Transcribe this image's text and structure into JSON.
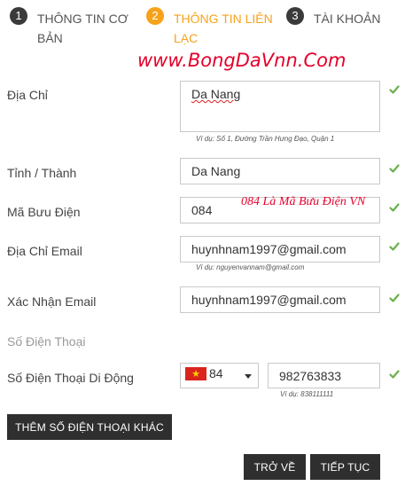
{
  "steps": [
    {
      "number": "1",
      "label_line1": "THÔNG TIN CƠ",
      "label_line2": "BẢN",
      "active": false
    },
    {
      "number": "2",
      "label_line1": "THÔNG TIN LIÊN",
      "label_line2": "LẠC",
      "active": true
    },
    {
      "number": "3",
      "label_line1": "TÀI KHOẢN",
      "label_line2": "",
      "active": false
    }
  ],
  "watermark": "www.BongDaVnn.Com",
  "annotation": "084 Là Mã Bưu Điện VN",
  "form": {
    "address": {
      "label": "Địa Chỉ",
      "value": "Da Nang",
      "hint": "Ví dụ: Số 1, Đường Trần Hưng Đạo, Quận 1"
    },
    "province": {
      "label": "Tỉnh / Thành",
      "value": "Da Nang"
    },
    "postal_code": {
      "label": "Mã Bưu Điện",
      "value": "084"
    },
    "email": {
      "label": "Địa Chỉ Email",
      "value": "huynhnam1997@gmail.com",
      "hint": "Ví dụ: nguyenvannam@gmail.com"
    },
    "confirm_email": {
      "label": "Xác Nhận Email",
      "value": "huynhnam1997@gmail.com"
    },
    "phone_section": {
      "label": "Số Điện Thoại"
    },
    "mobile": {
      "label": "Số Điện Thoại Di Động",
      "country_code": "84",
      "value": "982763833",
      "hint": "Ví dụ: 838111111"
    }
  },
  "buttons": {
    "add_phone": "THÊM SỐ ĐIỆN THOẠI KHÁC",
    "back": "TRỞ VỀ",
    "next": "TIẾP TỤC"
  },
  "colors": {
    "active_step": "#f7a21b",
    "inactive_step": "#3a3a3a",
    "check": "#6ab04c",
    "button_bg": "#2f2f2f",
    "watermark": "#e4002b"
  },
  "icons": {
    "valid": "check-icon",
    "dropdown": "caret-down-icon",
    "flag": "vietnam-flag-icon"
  }
}
